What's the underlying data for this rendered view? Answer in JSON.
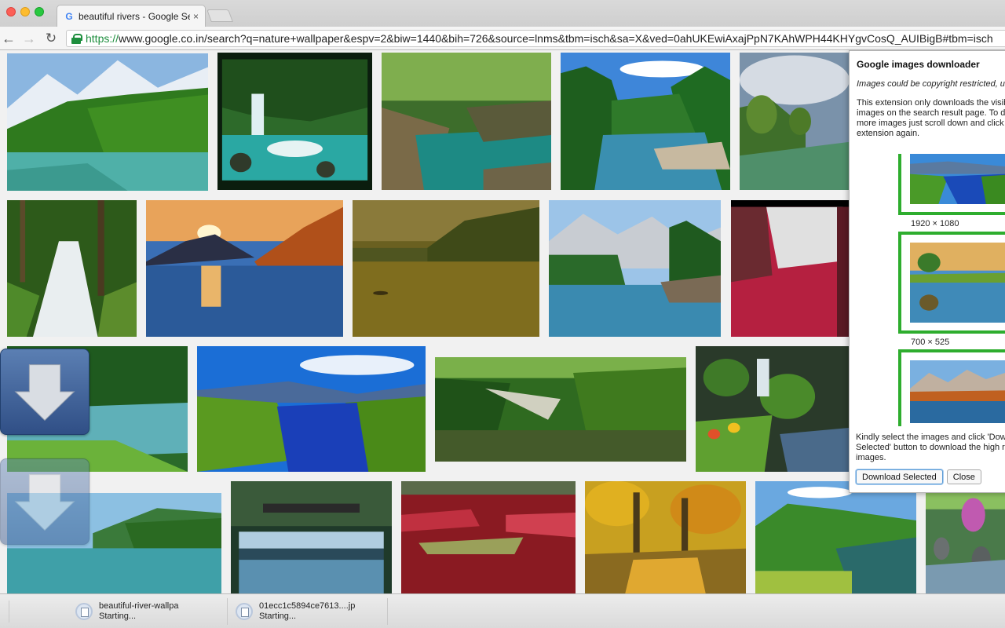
{
  "browser": {
    "tab_title": "beautiful rivers - Google Se",
    "tab_favicon": "G",
    "tab_close": "×",
    "url_scheme": "https://",
    "url_rest": "www.google.co.in/search?q=nature+wallpaper&espv=2&biw=1440&bih=726&source=lnms&tbm=isch&sa=X&ved=0ahUKEwiAxajPpN7KAhWPH44KHYgvCosQ_AUIBigB#tbm=isch",
    "back_icon": "←",
    "forward_icon": "→",
    "reload_icon": "↻"
  },
  "popup": {
    "title": "Google images downloader",
    "warning": "Images could be copyright restricted, use judiciously.",
    "info": "This extension only downloads the visible images on the search result page. To download more images just scroll down and click the extension again.",
    "candidates": [
      {
        "size": "1920 × 1080"
      },
      {
        "size": "700 × 525"
      },
      {
        "size": ""
      }
    ],
    "instruction": "Kindly select the images and click 'Download Selected' button to download the high resolution images.",
    "download_button": "Download Selected",
    "close_button": "Close"
  },
  "downloads": [
    {
      "filename": "beautiful-river-wallpa",
      "status": "Starting..."
    },
    {
      "filename": "01ecc1c5894ce7613....jp",
      "status": "Starting..."
    }
  ],
  "icons": {
    "download_overlay": "download-arrow-icon",
    "lock": "lock-icon",
    "file": "file-icon"
  }
}
